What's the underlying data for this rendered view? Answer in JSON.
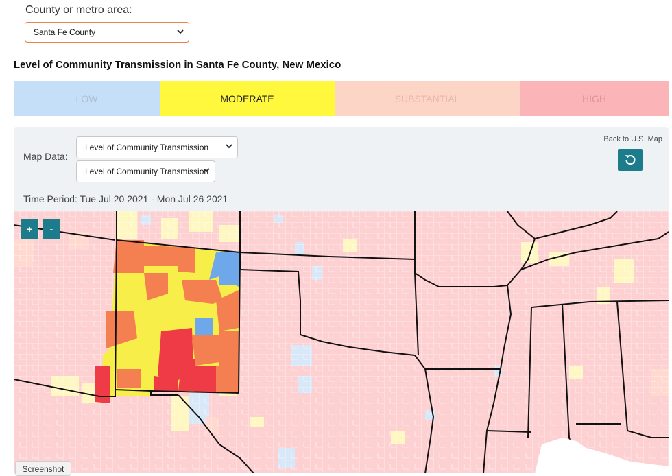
{
  "selector": {
    "label": "County or metro area:",
    "selected": "Santa Fe County"
  },
  "heading": "Level of Community Transmission in Santa Fe County, New Mexico",
  "levels": [
    {
      "label": "LOW",
      "color": "#c6dff8",
      "active": false
    },
    {
      "label": "MODERATE",
      "color": "#fff83d",
      "active": true
    },
    {
      "label": "SUBSTANTIAL",
      "color": "#fdd5c6",
      "active": false
    },
    {
      "label": "HIGH",
      "color": "#fbb5b8",
      "active": false
    }
  ],
  "panel": {
    "map_data_label": "Map Data:",
    "map_data_select_1": "Level of Community Transmission",
    "map_data_select_2": "Level of Community Transmission",
    "time_period": "Time Period: Tue Jul 20 2021 - Mon Jul 26 2021",
    "back_label": "Back to U.S. Map",
    "back_icon": "undo-icon"
  },
  "map": {
    "zoom_in": "+",
    "zoom_out": "-",
    "colors": {
      "low": "#6fa8ea",
      "moderate": "#f7ee4a",
      "substantial": "#f47f50",
      "high": "#ef3b45",
      "background_high": "#fdd0d2"
    }
  },
  "screenshot_button": "Screenshot"
}
